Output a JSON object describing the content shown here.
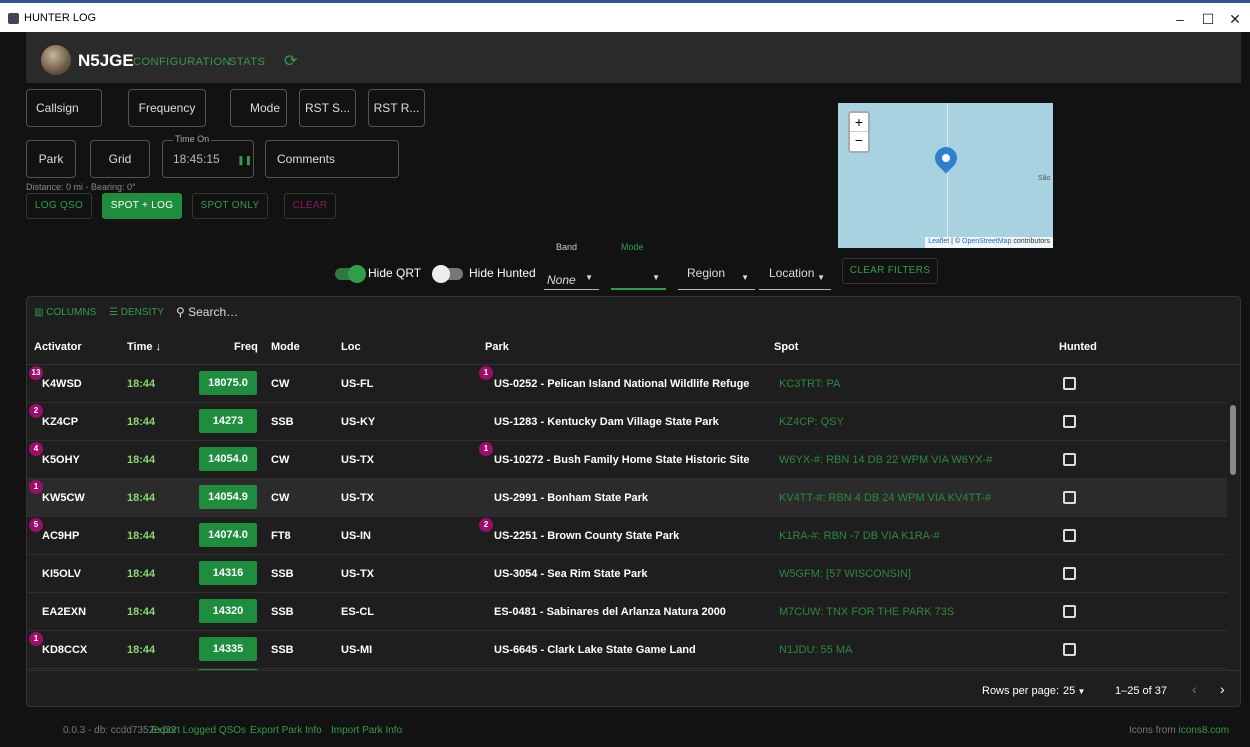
{
  "window": {
    "title": "HUNTER LOG",
    "minimize": "–",
    "maximize": "☐",
    "close": "✕"
  },
  "topbar": {
    "callsign": "N5JGE",
    "nav": [
      "CONFIGURATION",
      "STATS"
    ],
    "refresh_icon": "refresh-icon"
  },
  "form": {
    "callsign": "Callsign",
    "frequency": "Frequency",
    "mode": "Mode",
    "rst_sent": "RST S...",
    "rst_rcvd": "RST R...",
    "park": "Park",
    "grid": "Grid",
    "time_on_label": "Time On",
    "time_on": "18:45:15",
    "pause": "❚❚",
    "comments": "Comments",
    "distance": "Distance: 0 mi - Bearing: 0°",
    "log_qso": "LOG QSO",
    "spot_log": "SPOT + LOG",
    "spot_only": "SPOT ONLY",
    "clear": "CLEAR"
  },
  "map": {
    "zoom_in": "+",
    "zoom_out": "−",
    "attribution_leaflet": "Leaflet",
    "attribution_sep": " | © ",
    "attribution_osm": "OpenStreetMap",
    "attribution_tail": " contributors",
    "place": "São"
  },
  "filters": {
    "hide_qrt": "Hide QRT",
    "hide_hunted": "Hide Hunted",
    "band_caption": "Band",
    "band_value": "None",
    "mode_caption": "Mode",
    "mode_value": "",
    "region": "Region",
    "location": "Location",
    "clear_filters": "CLEAR FILTERS",
    "hide_qrt_on": true,
    "hide_hunted_on": false
  },
  "table": {
    "toolbar": {
      "columns": "COLUMNS",
      "density": "DENSITY",
      "search_placeholder": "Search…"
    },
    "headers": {
      "activator": "Activator",
      "time": "Time ↓",
      "freq": "Freq",
      "mode": "Mode",
      "loc": "Loc",
      "park": "Park",
      "spot": "Spot",
      "hunted": "Hunted"
    },
    "rows": [
      {
        "activator": "K4WSD",
        "activator_badge": "13",
        "time": "18:44",
        "freq": "18075.0",
        "mode": "CW",
        "loc": "US-FL",
        "park_badge": "1",
        "park": "US-0252 - Pelican Island National Wildlife Refuge",
        "spot": "KC3TRT: PA"
      },
      {
        "activator": "KZ4CP",
        "activator_badge": "2",
        "time": "18:44",
        "freq": "14273",
        "mode": "SSB",
        "loc": "US-KY",
        "park_badge": "",
        "park": "US-1283 - Kentucky Dam Village State Park",
        "spot": "KZ4CP: QSY"
      },
      {
        "activator": "K5OHY",
        "activator_badge": "4",
        "time": "18:44",
        "freq": "14054.0",
        "mode": "CW",
        "loc": "US-TX",
        "park_badge": "1",
        "park": "US-10272 - Bush Family Home State Historic Site",
        "spot": "W6YX-#: RBN 14 DB 22 WPM VIA W6YX-#"
      },
      {
        "activator": "KW5CW",
        "activator_badge": "1",
        "time": "18:44",
        "freq": "14054.9",
        "mode": "CW",
        "loc": "US-TX",
        "park_badge": "",
        "park": "US-2991 - Bonham State Park",
        "spot": "KV4TT-#: RBN 4 DB 24 WPM VIA KV4TT-#"
      },
      {
        "activator": "AC9HP",
        "activator_badge": "5",
        "time": "18:44",
        "freq": "14074.0",
        "mode": "FT8",
        "loc": "US-IN",
        "park_badge": "2",
        "park": "US-2251 - Brown County State Park",
        "spot": "K1RA-#: RBN -7 DB VIA K1RA-#"
      },
      {
        "activator": "KI5OLV",
        "activator_badge": "",
        "time": "18:44",
        "freq": "14316",
        "mode": "SSB",
        "loc": "US-TX",
        "park_badge": "",
        "park": "US-3054 - Sea Rim State Park",
        "spot": "W5GFM: [57 WISCONSIN]"
      },
      {
        "activator": "EA2EXN",
        "activator_badge": "",
        "time": "18:44",
        "freq": "14320",
        "mode": "SSB",
        "loc": "ES-CL",
        "park_badge": "",
        "park": "ES-0481 - Sabinares del Arlanza Natura 2000",
        "spot": "M7CUW: TNX FOR THE PARK 73S"
      },
      {
        "activator": "KD8CCX",
        "activator_badge": "1",
        "time": "18:44",
        "freq": "14335",
        "mode": "SSB",
        "loc": "US-MI",
        "park_badge": "",
        "park": "US-6645 - Clark Lake State Game Land",
        "spot": "N1JDU: 55 MA"
      }
    ],
    "rows_per_page_label": "Rows per page:",
    "rows_per_page": "25",
    "range": "1–25 of 37",
    "prev": "‹",
    "next": "›"
  },
  "footer": {
    "version": "0.0.3 - db: ccdd7352ed32",
    "export_logged": "Export Logged QSOs",
    "export_park": "Export Park Info",
    "import_park": "Import Park Info",
    "icons_prefix": "Icons from ",
    "icons_link": "icons8.com"
  },
  "colors": {
    "accent": "#2e9e4a",
    "badge": "#9a0f6a",
    "freq_bg": "#1e8e3e",
    "background": "#121212"
  }
}
